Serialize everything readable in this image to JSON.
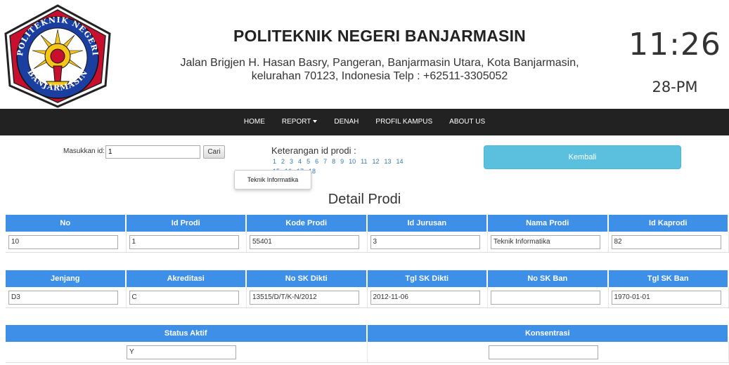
{
  "header": {
    "institution_name": "POLITEKNIK NEGERI BANJARMASIN",
    "address_line1": "Jalan Brigjen H. Hasan Basry, Pangeran, Banjarmasin Utara, Kota Banjarmasin,",
    "address_line2": "kelurahan 70123, Indonesia Telp : +62511-3305052",
    "logo_text_top": "POLITEKNIK NEGERI",
    "logo_text_bottom": "BANJARMASIN",
    "clock_time": "11:26",
    "clock_date": "28-PM"
  },
  "nav": {
    "items": [
      {
        "label": "HOME"
      },
      {
        "label": "REPORT"
      },
      {
        "label": "DENAH"
      },
      {
        "label": "PROFIL KAMPUS"
      },
      {
        "label": "ABOUT US"
      }
    ]
  },
  "search": {
    "label": "Masukkan id:",
    "value": "1",
    "button_label": "Cari"
  },
  "keterangan": {
    "title": "Keterangan id prodi :",
    "ids": [
      "1",
      "2",
      "3",
      "4",
      "5",
      "6",
      "7",
      "8",
      "9",
      "10",
      "11",
      "12",
      "13",
      "14",
      "15",
      "16",
      "17",
      "18"
    ],
    "tooltip": "Teknik Informatika"
  },
  "kembali_label": "Kembali",
  "section_title": "Detail Prodi",
  "table1": {
    "headers": [
      "No",
      "Id Prodi",
      "Kode Prodi",
      "Id Jurusan",
      "Nama Prodi",
      "Id Kaprodi"
    ],
    "values": [
      "10",
      "1",
      "55401",
      "3",
      "Teknik Informatika",
      "82"
    ]
  },
  "table2": {
    "headers": [
      "Jenjang",
      "Akreditasi",
      "No SK Dikti",
      "Tgl SK Dikti",
      "No SK Ban",
      "Tgl SK Ban"
    ],
    "values": [
      "D3",
      "C",
      "13515/D/T/K-N/2012",
      "2012-11-06",
      "",
      "1970-01-01"
    ]
  },
  "table3": {
    "headers": [
      "Status Aktif",
      "Konsentrasi"
    ],
    "values": [
      "Y",
      ""
    ]
  },
  "colors": {
    "navbar": "#222222",
    "table_header": "#3d8fe8",
    "kembali_button": "#5bc0de",
    "link": "#337ab7"
  }
}
